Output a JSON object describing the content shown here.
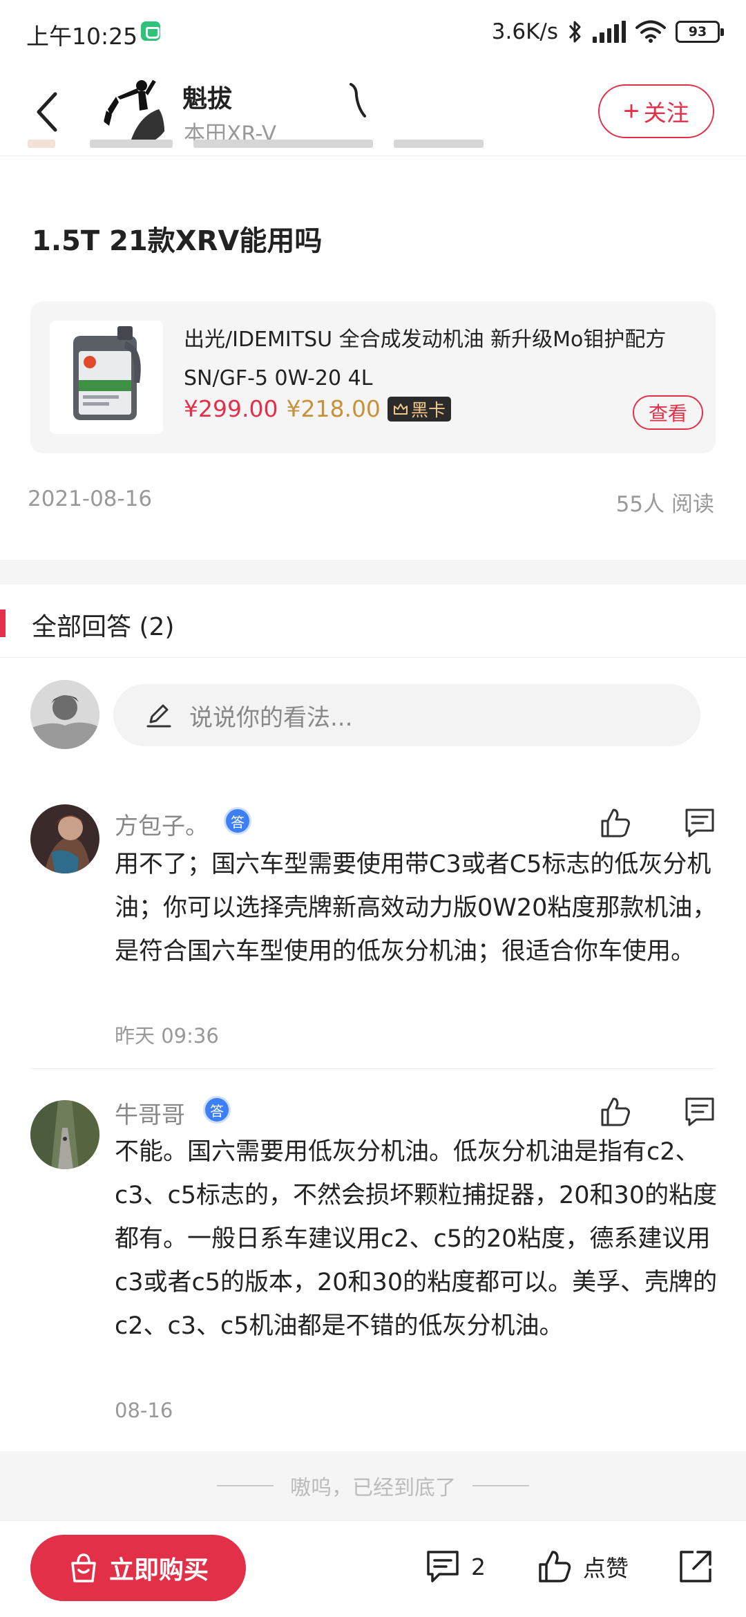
{
  "status_bar": {
    "time": "上午10:25",
    "net_speed": "3.6K/s",
    "battery": "93"
  },
  "header": {
    "author_name": "魁拔",
    "author_sub": "本田XR-V",
    "follow_label": "关注"
  },
  "question": {
    "title": "1.5T 21款XRV能用吗",
    "date": "2021-08-16",
    "read_count": "55人 阅读"
  },
  "product": {
    "name": "出光/IDEMITSU 全合成发动机油 新升级Mo钼护配方 SN/GF-5 0W-20 4L",
    "price_original": "¥299.00",
    "price_black": "¥218.00",
    "black_card_label": "黑卡",
    "view_label": "查看"
  },
  "answers_section": {
    "title": "全部回答 (2)",
    "comment_placeholder": "说说你的看法..."
  },
  "answers": [
    {
      "user": "方包子。",
      "badge": "答",
      "text": "用不了；国六车型需要使用带C3或者C5标志的低灰分机油；你可以选择壳牌新高效动力版0W20粘度那款机油，是符合国六车型使用的低灰分机油；很适合你车使用。",
      "time": "昨天 09:36"
    },
    {
      "user": "牛哥哥",
      "badge": "答",
      "text": "不能。国六需要用低灰分机油。低灰分机油是指有c2、c3、c5标志的，不然会损坏颗粒捕捉器，20和30的粘度都有。一般日系车建议用c2、c5的20粘度，德系建议用c3或者c5的版本，20和30的粘度都可以。美孚、壳牌的c2、c3、c5机油都是不错的低灰分机油。",
      "time": "08-16"
    }
  ],
  "end_text": "嗷呜，已经到底了",
  "bottom_bar": {
    "buy_label": "立即购买",
    "comment_count": "2",
    "like_label": "点赞"
  },
  "colors": {
    "accent": "#e33049",
    "gold": "#c6923c",
    "muted": "#999999",
    "badge_blue": "#3d7ff5"
  },
  "icons": [
    "back-arrow-icon",
    "bluetooth-icon",
    "signal-icon",
    "wifi-icon",
    "battery-icon",
    "plus-icon",
    "crown-icon",
    "pen-icon",
    "thumbs-up-icon",
    "reply-icon",
    "shopping-bag-icon",
    "comment-icon",
    "share-icon"
  ]
}
